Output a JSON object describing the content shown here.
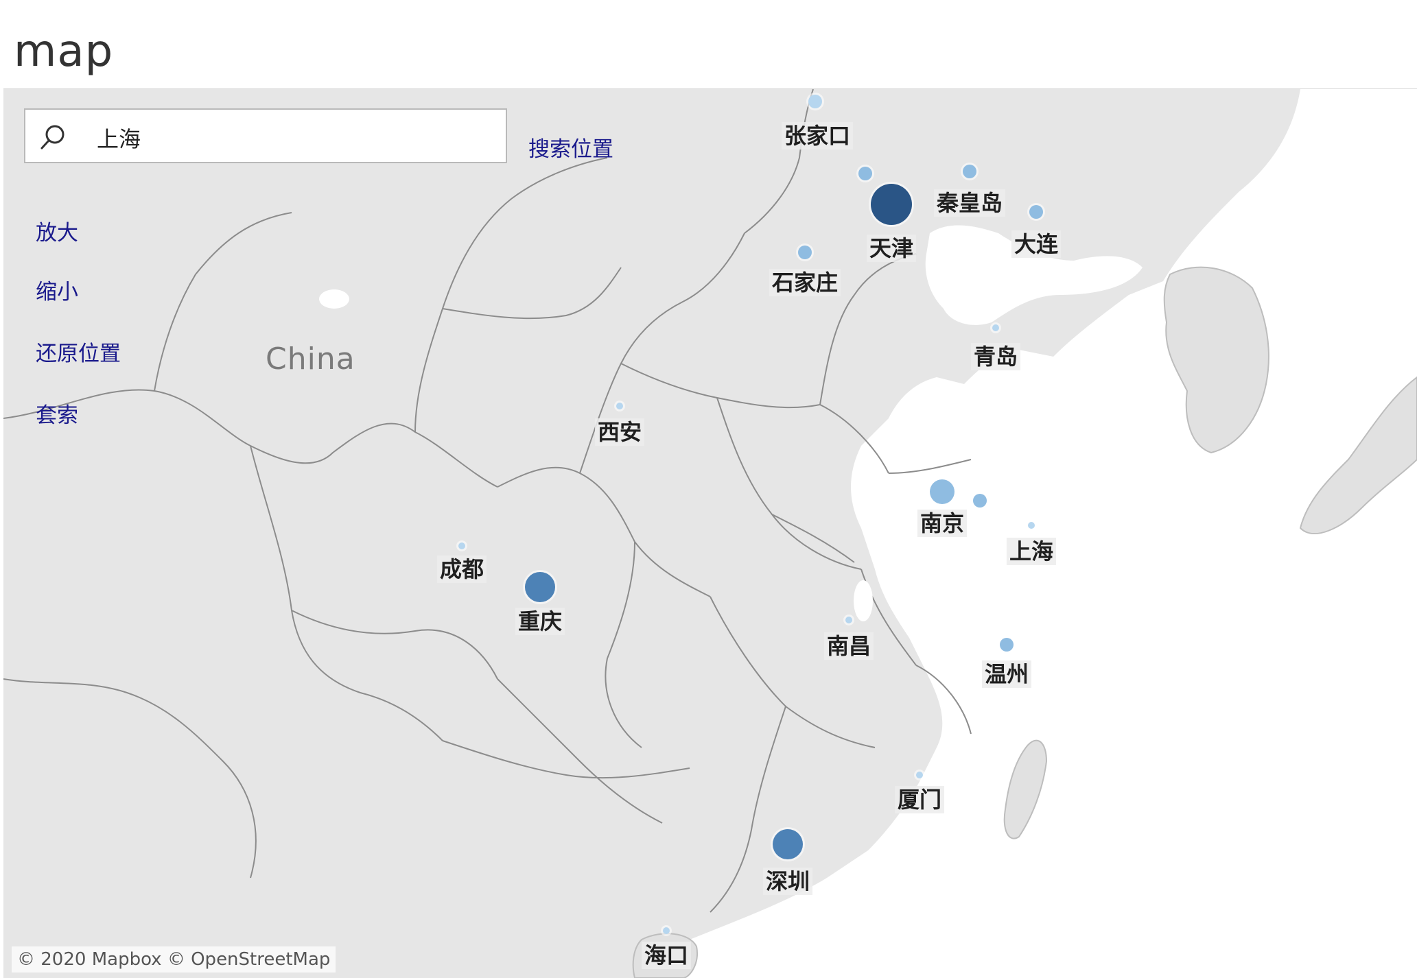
{
  "page": {
    "title": "map"
  },
  "search": {
    "value": "上海",
    "button_label": "搜索位置",
    "icon": "search-icon"
  },
  "controls": {
    "zoom_in": "放大",
    "zoom_out": "缩小",
    "reset": "还原位置",
    "lasso": "套索"
  },
  "map": {
    "country_label": "China",
    "attribution": "© 2020 Mapbox © OpenStreetMap",
    "colors": {
      "land": "#e6e6e6",
      "sea": "#ffffff",
      "border": "#8c8c8c",
      "dark": "#2a5586",
      "medium": "#4d82b6",
      "light": "#8fbce1",
      "pale": "#b6d6ef"
    }
  },
  "cities": [
    {
      "name": "张家口",
      "size": "small",
      "shade": "pale"
    },
    {
      "name": "天津",
      "size": "xlarge",
      "shade": "dark"
    },
    {
      "name": "秦皇岛",
      "size": "small",
      "shade": "light"
    },
    {
      "name": "大连",
      "size": "small",
      "shade": "light"
    },
    {
      "name": "石家庄",
      "size": "small",
      "shade": "light"
    },
    {
      "name": "青岛",
      "size": "tiny",
      "shade": "pale"
    },
    {
      "name": "西安",
      "size": "tiny",
      "shade": "pale"
    },
    {
      "name": "南京",
      "size": "medium",
      "shade": "light"
    },
    {
      "name": "上海",
      "size": "tiny",
      "shade": "pale"
    },
    {
      "name": "成都",
      "size": "tiny",
      "shade": "pale"
    },
    {
      "name": "重庆",
      "size": "large",
      "shade": "medium"
    },
    {
      "name": "南昌",
      "size": "tiny",
      "shade": "pale"
    },
    {
      "name": "温州",
      "size": "small",
      "shade": "light"
    },
    {
      "name": "厦门",
      "size": "tiny",
      "shade": "pale"
    },
    {
      "name": "深圳",
      "size": "large",
      "shade": "medium"
    },
    {
      "name": "海口",
      "size": "tiny",
      "shade": "pale"
    }
  ],
  "unlabeled_points": [
    {
      "size": "small",
      "shade": "light"
    },
    {
      "size": "small",
      "shade": "light"
    }
  ]
}
